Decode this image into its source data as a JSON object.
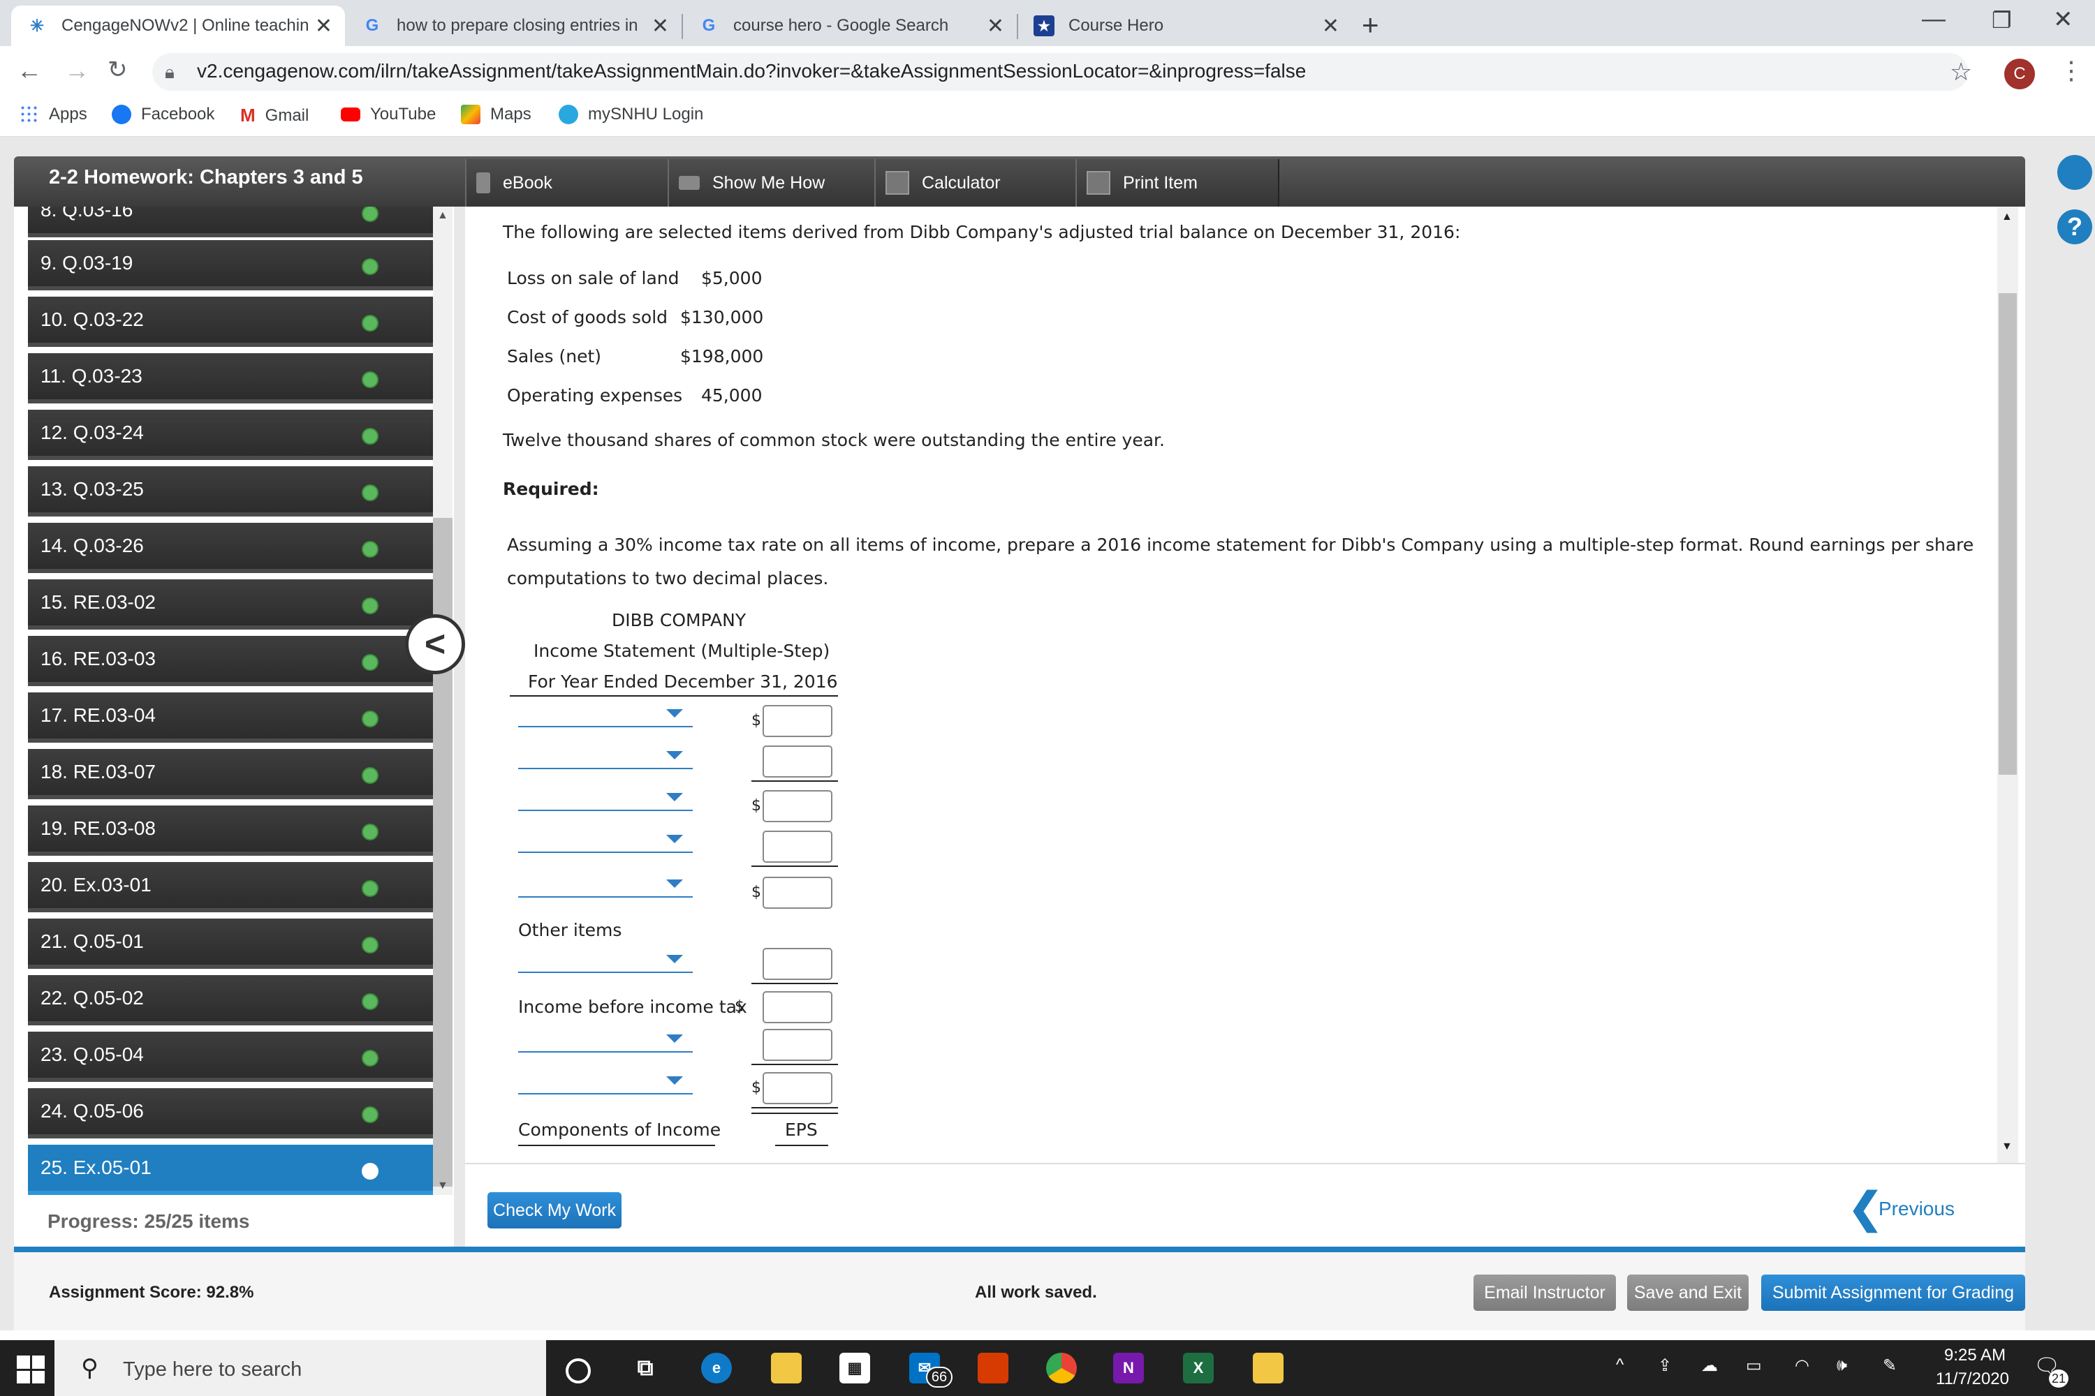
{
  "browser": {
    "tabs": [
      {
        "title": "CengageNOWv2 | Online teachin",
        "icon": "cengage-icon",
        "active": true
      },
      {
        "title": "how to prepare closing entries in",
        "icon": "google-icon",
        "active": false
      },
      {
        "title": "course hero - Google Search",
        "icon": "google-icon",
        "active": false
      },
      {
        "title": "Course Hero",
        "icon": "coursehero-icon",
        "active": false
      }
    ],
    "url": "v2.cengagenow.com/ilrn/takeAssignment/takeAssignmentMain.do?invoker=&takeAssignmentSessionLocator=&inprogress=false",
    "profile_initial": "C",
    "bookmarks": [
      "Apps",
      "Facebook",
      "Gmail",
      "YouTube",
      "Maps",
      "mySNHU Login"
    ]
  },
  "assignment": {
    "title": "2-2 Homework: Chapters 3 and 5",
    "tools": [
      "eBook",
      "Show Me How",
      "Calculator",
      "Print Item"
    ],
    "questions": [
      "8. Q.03-16",
      "9. Q.03-19",
      "10. Q.03-22",
      "11. Q.03-23",
      "12. Q.03-24",
      "13. Q.03-25",
      "14. Q.03-26",
      "15. RE.03-02",
      "16. RE.03-03",
      "17. RE.03-04",
      "18. RE.03-07",
      "19. RE.03-08",
      "20. Ex.03-01",
      "21. Q.05-01",
      "22. Q.05-02",
      "23. Q.05-04",
      "24. Q.05-06",
      "25. Ex.05-01"
    ],
    "progress": "Progress:  25/25 items"
  },
  "problem": {
    "intro": "The following are selected items derived from Dibb Company's adjusted trial balance on December 31, 2016:",
    "items": [
      {
        "label": "Loss on sale of land",
        "value": "$5,000"
      },
      {
        "label": "Cost of goods sold",
        "value": "$130,000"
      },
      {
        "label": "Sales (net)",
        "value": "$198,000"
      },
      {
        "label": "Operating expenses",
        "value": "45,000"
      }
    ],
    "shares_note": "Twelve thousand shares of common stock were outstanding the entire year.",
    "required_label": "Required:",
    "instructions_1": "Assuming a 30% income tax rate on all items of income, prepare a 2016 income statement for Dibb's Company using a multiple-step format. Round earnings per share",
    "instructions_2": "computations to two decimal places.",
    "statement": {
      "company": "DIBB COMPANY",
      "title": "Income Statement (Multiple-Step)",
      "period": "For Year Ended December 31, 2016",
      "other_items": "Other items",
      "income_before_tax": "Income before income tax",
      "components": "Components of Income",
      "eps": "EPS",
      "currency": "$"
    }
  },
  "buttons": {
    "check": "Check My Work",
    "previous": "Previous",
    "email": "Email Instructor",
    "save_exit": "Save and Exit",
    "submit": "Submit Assignment for Grading"
  },
  "footer": {
    "score": "Assignment Score: 92.8%",
    "saved": "All work saved."
  },
  "taskbar": {
    "search_placeholder": "Type here to search",
    "time": "9:25 AM",
    "date": "11/7/2020",
    "mail_badge": "66",
    "notif_badge": "21"
  },
  "colors": {
    "accent": "#1f7fc0",
    "check_green": "#5cb85c",
    "header_dark": "#3b3b3b"
  }
}
